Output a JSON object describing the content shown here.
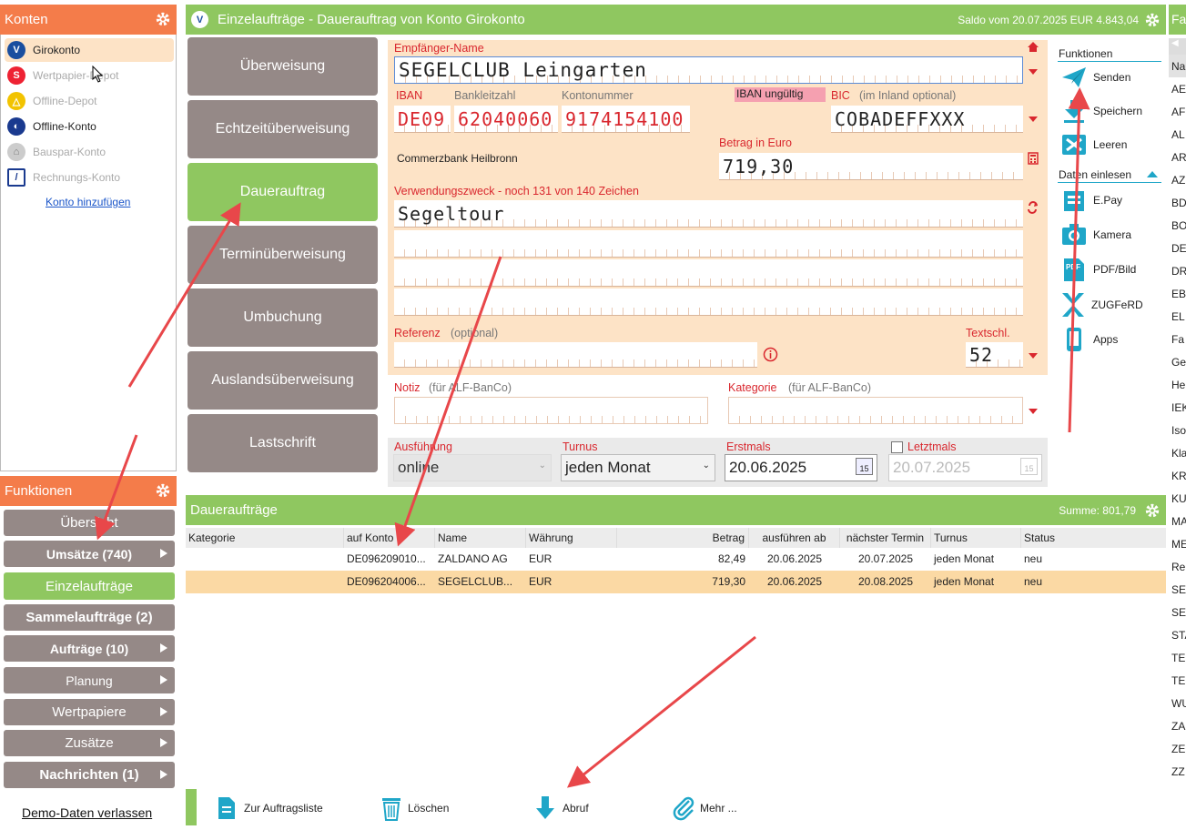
{
  "konten": {
    "title": "Konten",
    "accounts": [
      {
        "label": "Girokonto",
        "active": true
      },
      {
        "label": "Wertpapier-Depot",
        "active": false
      },
      {
        "label": "Offline-Depot",
        "active": false
      },
      {
        "label": "Offline-Konto",
        "active": true
      },
      {
        "label": "Bauspar-Konto",
        "active": false
      },
      {
        "label": "Rechnungs-Konto",
        "active": false
      }
    ],
    "add_link": "Konto hinzufügen"
  },
  "funktionen_left": {
    "title": "Funktionen",
    "items": [
      "Übersicht",
      "Umsätze (740)",
      "Einzelaufträge",
      "Sammelaufträge (2)",
      "Aufträge (10)",
      "Planung",
      "Wertpapiere",
      "Zusätze",
      "Nachrichten (1)"
    ],
    "exit": "Demo-Daten verlassen"
  },
  "main": {
    "title": "Einzelaufträge - Dauerauftrag von Konto Girokonto",
    "saldo": "Saldo vom 20.07.2025 EUR 4.843,04"
  },
  "types": [
    "Überweisung",
    "Echtzeitüberweisung",
    "Dauerauftrag",
    "Terminüberweisung",
    "Umbuchung",
    "Auslandsüberweisung",
    "Lastschrift"
  ],
  "form": {
    "empfaenger_label": "Empfänger-Name",
    "empfaenger": "SEGELCLUB Leingarten",
    "iban_label": "IBAN",
    "blz_label": "Bankleitzahl",
    "kto_label": "Kontonummer",
    "iban_country": "DE09",
    "blz": "62040060",
    "kto": "9174154100",
    "iban_warning": "IBAN ungültig",
    "bic_label": "BIC",
    "bic_hint": "(im Inland optional)",
    "bic": "COBADEFFXXX",
    "bank_name": "Commerzbank Heilbronn",
    "betrag_label": "Betrag in Euro",
    "betrag": "719,30",
    "zweck_label": "Verwendungszweck - noch 131 von 140 Zeichen",
    "zweck": "Segeltour",
    "referenz_label": "Referenz",
    "referenz_hint": "(optional)",
    "textschl_label": "Textschl.",
    "textschl": "52",
    "notiz_label": "Notiz",
    "notiz_hint": "(für ALF-BanCo)",
    "kategorie_label": "Kategorie",
    "kategorie_hint": "(für ALF-BanCo)",
    "ausfuehrung_label": "Ausführung",
    "ausfuehrung": "online",
    "turnus_label": "Turnus",
    "turnus": "jeden Monat",
    "erstmals_label": "Erstmals",
    "erstmals": "20.06.2025",
    "letztmals_label": "Letztmals",
    "letztmals": "20.07.2025"
  },
  "funktionen_right": {
    "title": "Funktionen",
    "items": [
      "Senden",
      "Speichern",
      "Leeren"
    ],
    "daten_title": "Daten einlesen",
    "daten": [
      "E.Pay",
      "Kamera",
      "PDF/Bild",
      "ZUGFeRD",
      "Apps"
    ]
  },
  "dauerauftraege": {
    "title": "Daueraufträge",
    "summe": "Summe: 801,79",
    "columns": [
      "Kategorie",
      "auf Konto",
      "Name",
      "Währung",
      "Betrag",
      "ausführen ab",
      "nächster Termin",
      "Turnus",
      "Status"
    ],
    "rows": [
      [
        "",
        "DE096209010...",
        "ZALDANO AG",
        "EUR",
        "82,49",
        "20.06.2025",
        "20.07.2025",
        "jeden Monat",
        "neu"
      ],
      [
        "",
        "DE096204006...",
        "SEGELCLUB...",
        "EUR",
        "719,30",
        "20.06.2025",
        "20.08.2025",
        "jeden Monat",
        "neu"
      ]
    ]
  },
  "bottom": [
    "Zur Auftragsliste",
    "Löschen",
    "Abruf",
    "Mehr ..."
  ],
  "side_list": {
    "header": "Fa",
    "items": [
      "Na",
      "AE",
      "AF",
      "AL",
      "AR",
      "AZ",
      "BD",
      "BO",
      "DE",
      "DR",
      "EB",
      "EL",
      "Fa",
      "Ge",
      "He",
      "IEK",
      "Iso",
      "Kla",
      "KR",
      "KU",
      "MA",
      "ME",
      "Re",
      "SE",
      "SE",
      "STA",
      "TE",
      "TE",
      "WU",
      "ZA",
      "ZE",
      "ZZ"
    ]
  },
  "colors": {
    "orange": "#f47c4a",
    "green": "#8fc760",
    "grey_button": "#958987",
    "form_bg": "#fde3c6",
    "red": "#d9272e",
    "teal": "#1fa6c8"
  }
}
